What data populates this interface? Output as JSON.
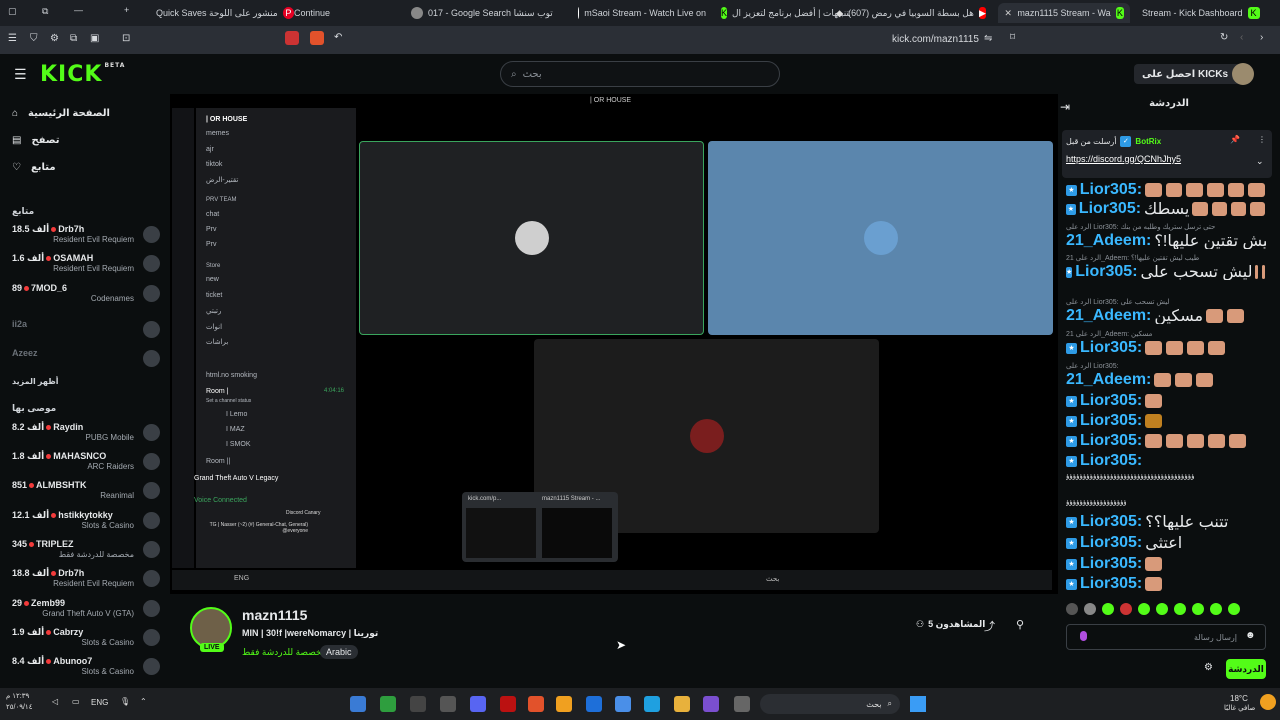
{
  "browser": {
    "tabs": [
      {
        "label": "Quick Saves منشور على اللوحة",
        "icon": "pinterest-icon",
        "x": "150"
      },
      {
        "label": "Continue",
        "icon": "browser-icon"
      },
      {
        "label": "017 - Google Search توب سنشا",
        "icon": "google-icon"
      },
      {
        "label": "mSaoi Stream - Watch Live on",
        "icon": "kick-icon"
      },
      {
        "label": "التنبيهات | أفضل برنامج لتعزيز ال",
        "icon": "alert-icon"
      },
      {
        "label": "(607) هل بسطة السوبيا في رمض",
        "icon": "youtube-icon"
      },
      {
        "label": "mazn1115 Stream - Wa",
        "icon": "kick-icon"
      },
      {
        "label": "Stream - Kick Dashboard",
        "icon": "kick-icon"
      }
    ],
    "url": "kick.com/mazn1115"
  },
  "site": {
    "logo": "KICK",
    "logo_beta": "BETA",
    "search_placeholder": "بحث",
    "get_kicks": "احصل على KICKs"
  },
  "sidebar": {
    "nav": [
      {
        "label": "الصفحة الرئيسية",
        "icon": "home-icon"
      },
      {
        "label": "تصفح",
        "icon": "browse-icon"
      },
      {
        "label": "متابع",
        "icon": "heart-icon"
      }
    ],
    "following_title": "متابع",
    "following": [
      {
        "name": "Drb7h",
        "viewers": "18.5 ألف",
        "game": "Resident Evil Requiem"
      },
      {
        "name": "OSAMAH",
        "viewers": "1.6 ألف",
        "game": "Resident Evil Requiem"
      },
      {
        "name": "7MOD_6",
        "viewers": "89",
        "game": "Codenames"
      },
      {
        "name": "ii2a",
        "viewers": "",
        "game": ""
      },
      {
        "name": "Azeez",
        "viewers": "",
        "game": ""
      }
    ],
    "show_more": "أظهر المزيد",
    "recommended_title": "موصى بها",
    "recommended": [
      {
        "name": "Raydin",
        "viewers": "8.2 ألف",
        "game": "PUBG Mobile"
      },
      {
        "name": "MAHASNCO",
        "viewers": "1.8 ألف",
        "game": "ARC Raiders"
      },
      {
        "name": "ALMBSHTK",
        "viewers": "851",
        "game": "Reanimal"
      },
      {
        "name": "hstikkytokky",
        "viewers": "12.1 ألف",
        "game": "Slots & Casino"
      },
      {
        "name": "TRIPLEZ",
        "viewers": "345",
        "game": "مخصصة للدردشة فقط"
      },
      {
        "name": "Drb7h",
        "viewers": "18.8 ألف",
        "game": "Resident Evil Requiem"
      },
      {
        "name": "Zemb99",
        "viewers": "29",
        "game": "Grand Theft Auto V (GTA)"
      },
      {
        "name": "Cabrzy",
        "viewers": "1.9 ألف",
        "game": "Slots & Casino"
      },
      {
        "name": "Abunoo7",
        "viewers": "8.4 ألف",
        "game": "Slots & Casino"
      }
    ]
  },
  "video": {
    "discord_server": "| OR HOUSE",
    "channels": [
      "memes",
      "ajr",
      "tiktok",
      "تقتير-الرض",
      "PRV TEAM",
      "chat",
      "Prv",
      "Prv",
      "Store",
      "new",
      "ticket",
      "رتبتي",
      "انوات",
      "براشات",
      "html.no smoking",
      "Room |",
      "Set a channel status",
      "I Lemo",
      "I MAZ",
      "I SMOK",
      "Room ||"
    ],
    "game_title": "Grand Theft Auto V Legacy",
    "voice_connected": "Voice Connected",
    "canary": "Discord Canary",
    "canary_msg": "TG | Nasser (~2) (#) General-Chat, General) @everyone",
    "thumb_tabs": [
      "kick.com/p...",
      "mazn1115 Stream - ..."
    ],
    "time": "4:04:16",
    "inner_lang": "ENG",
    "inner_search": "بحث"
  },
  "stream": {
    "streamer": "mazn1115",
    "live": "LIVE",
    "title": "MIN | 30!f |wereNomarcy | تورينا",
    "category": "مخصصة للدردشة فقط",
    "tag": "Arabic",
    "viewers": "5 المشاهدون"
  },
  "chat": {
    "header": "الدردشة",
    "pinned_by": "أرسلت من قبل",
    "pinned_user": "BotRix",
    "pinned_link": "https://discord.gg/QCNhJhy5",
    "messages": [
      {
        "user": "Lior305:",
        "text": ""
      },
      {
        "user": "Lior305:",
        "text": "يسطك"
      },
      {
        "user": "21_Adeem:",
        "text": "طيب ليش تقتين عليها!؟",
        "reply": "الرد على Lior305: حتى ترسل ستريك وطلبه من بنك"
      },
      {
        "user": "Lior305:",
        "text": "ليش تسحب على",
        "reply": "الرد على 21_Adeem: طيب ليش تقتين عليها!؟"
      },
      {
        "user": "21_Adeem:",
        "text": "مسكين",
        "reply": "الرد على Lior305: ليش تسحب على"
      },
      {
        "user": "Lior305:",
        "text": "",
        "reply": "الرد على 21_Adeem: مسكين"
      },
      {
        "user": "21_Adeem:",
        "text": "",
        "reply": "الرد على Lior305:"
      },
      {
        "user": "Lior305:",
        "text": ""
      },
      {
        "user": "Lior305:",
        "text": ""
      },
      {
        "user": "Lior305:",
        "text": ""
      },
      {
        "user": "Lior305:",
        "text": ""
      },
      {
        "user": "Lior305:",
        "text": "تتنب عليها؟؟"
      },
      {
        "user": "Lior305:",
        "text": "اعتثي"
      },
      {
        "user": "Lior305:",
        "text": ""
      },
      {
        "user": "Lior305:",
        "text": ""
      }
    ],
    "spam_line": "ؤؤؤؤؤؤؤؤؤؤؤؤؤؤؤؤؤؤؤؤؤؤؤؤؤؤؤؤؤؤؤؤؤؤؤؤؤؤ",
    "input_placeholder": "إرسال رسالة",
    "send_button": "الدردشة"
  },
  "taskbar": {
    "lang": "ENG",
    "time": "١٢:٣٩ م",
    "date": "٢٥/٠٩/١٤",
    "search": "بحث",
    "weather": "18°C",
    "weather_desc": "صافي غالبًا"
  }
}
